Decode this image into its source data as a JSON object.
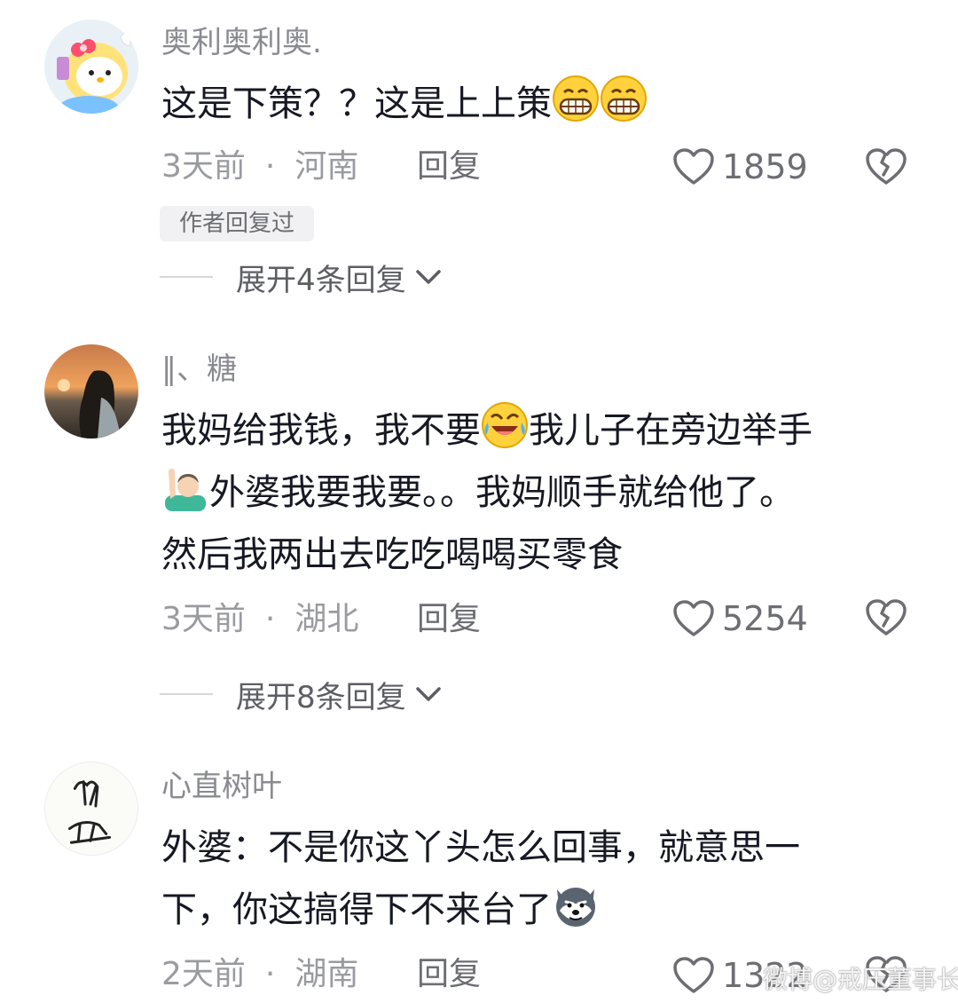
{
  "comments": [
    {
      "username": "奥利奥利奥.",
      "text_lines": [
        "这是下策？？这是上上策"
      ],
      "time": "3天前",
      "location": "河南",
      "reply_label": "回复",
      "likes": "1859",
      "author_replied_badge": "作者回复过",
      "expand_label": "展开4条回复",
      "emoji": [
        "grin-emoji",
        "grin-emoji"
      ]
    },
    {
      "username": "‖、糖",
      "text_lines": [
        "我妈给我钱，我不要",
        "我儿子在旁边举手",
        "外婆我要我要。。我妈顺手就给他了。",
        "然后我两出去吃吃喝喝买零食"
      ],
      "time": "3天前",
      "location": "湖北",
      "reply_label": "回复",
      "likes": "5254",
      "expand_label": "展开8条回复",
      "emoji": [
        "laugh-cry-emoji",
        "raising-hand-emoji"
      ]
    },
    {
      "username": "心直树叶",
      "text_lines": [
        "外婆：不是你这丫头怎么回事，就意思一",
        "下，你这搞得下不来台了"
      ],
      "time": "2天前",
      "location": "湖南",
      "reply_label": "回复",
      "likes": "1322",
      "emoji": [
        "husky-dog-emoji"
      ]
    }
  ],
  "separator": "·",
  "watermark": "微博@戒压董事长",
  "colors": {
    "text": "#161823",
    "meta": "#9a9ba0",
    "accent_line": "#d6d7da"
  }
}
